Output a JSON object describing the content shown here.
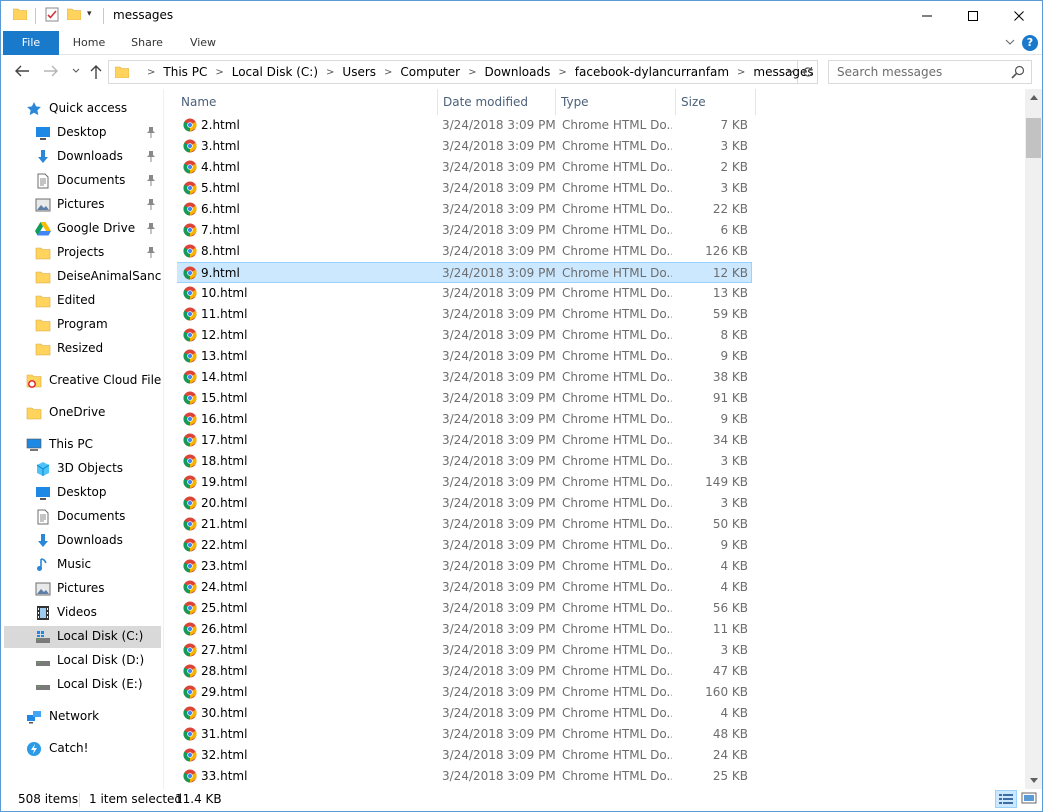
{
  "window": {
    "title": "messages",
    "controls": {
      "minimize": "—",
      "maximize": "☐",
      "close": "✕"
    }
  },
  "ribbon": {
    "tabs": [
      "File",
      "Home",
      "Share",
      "View"
    ],
    "help_label": "?"
  },
  "address": {
    "crumbs": [
      "This PC",
      "Local Disk (C:)",
      "Users",
      "Computer",
      "Downloads",
      "facebook-dylancurranfam",
      "messages"
    ]
  },
  "search": {
    "placeholder": "Search messages",
    "value": ""
  },
  "navigation": {
    "items": [
      {
        "label": "Quick access",
        "icon": "star-icon",
        "indent": 0,
        "pinned": false
      },
      {
        "label": "Desktop",
        "icon": "desktop-icon",
        "indent": 1,
        "pinned": true
      },
      {
        "label": "Downloads",
        "icon": "download-arrow-icon",
        "indent": 1,
        "pinned": true
      },
      {
        "label": "Documents",
        "icon": "document-icon",
        "indent": 1,
        "pinned": true
      },
      {
        "label": "Pictures",
        "icon": "pictures-icon",
        "indent": 1,
        "pinned": true
      },
      {
        "label": "Google Drive",
        "icon": "google-drive-icon",
        "indent": 1,
        "pinned": true
      },
      {
        "label": "Projects",
        "icon": "folder-icon",
        "indent": 1,
        "pinned": true
      },
      {
        "label": "DeiseAnimalSanctu",
        "icon": "folder-icon",
        "indent": 1,
        "pinned": false
      },
      {
        "label": "Edited",
        "icon": "folder-icon",
        "indent": 1,
        "pinned": false
      },
      {
        "label": "Program",
        "icon": "folder-icon",
        "indent": 1,
        "pinned": false
      },
      {
        "label": "Resized",
        "icon": "folder-icon",
        "indent": 1,
        "pinned": false
      },
      {
        "label": "Creative Cloud Files",
        "icon": "creative-cloud-icon",
        "indent": 0,
        "pinned": false
      },
      {
        "label": "OneDrive",
        "icon": "onedrive-icon",
        "indent": 0,
        "pinned": false
      },
      {
        "label": "This PC",
        "icon": "computer-icon",
        "indent": 0,
        "pinned": false
      },
      {
        "label": "3D Objects",
        "icon": "cube-icon",
        "indent": 1,
        "pinned": false
      },
      {
        "label": "Desktop",
        "icon": "desktop-icon",
        "indent": 1,
        "pinned": false
      },
      {
        "label": "Documents",
        "icon": "document-icon",
        "indent": 1,
        "pinned": false
      },
      {
        "label": "Downloads",
        "icon": "download-arrow-icon",
        "indent": 1,
        "pinned": false
      },
      {
        "label": "Music",
        "icon": "music-note-icon",
        "indent": 1,
        "pinned": false
      },
      {
        "label": "Pictures",
        "icon": "pictures-icon",
        "indent": 1,
        "pinned": false
      },
      {
        "label": "Videos",
        "icon": "film-icon",
        "indent": 1,
        "pinned": false
      },
      {
        "label": "Local Disk (C:)",
        "icon": "system-drive-icon",
        "indent": 1,
        "pinned": false,
        "selected": true
      },
      {
        "label": "Local Disk (D:)",
        "icon": "drive-icon",
        "indent": 1,
        "pinned": false
      },
      {
        "label": "Local Disk (E:)",
        "icon": "drive-icon",
        "indent": 1,
        "pinned": false
      },
      {
        "label": "Network",
        "icon": "network-icon",
        "indent": 0,
        "pinned": false
      },
      {
        "label": "Catch!",
        "icon": "catch-icon",
        "indent": 0,
        "pinned": false
      }
    ]
  },
  "filelist": {
    "columns": [
      "Name",
      "Date modified",
      "Type",
      "Size"
    ],
    "sort_arrow": "^",
    "files": [
      {
        "name": "2.html",
        "date": "3/24/2018 3:09 PM",
        "type": "Chrome HTML Do...",
        "size": "7 KB"
      },
      {
        "name": "3.html",
        "date": "3/24/2018 3:09 PM",
        "type": "Chrome HTML Do...",
        "size": "3 KB"
      },
      {
        "name": "4.html",
        "date": "3/24/2018 3:09 PM",
        "type": "Chrome HTML Do...",
        "size": "2 KB"
      },
      {
        "name": "5.html",
        "date": "3/24/2018 3:09 PM",
        "type": "Chrome HTML Do...",
        "size": "3 KB"
      },
      {
        "name": "6.html",
        "date": "3/24/2018 3:09 PM",
        "type": "Chrome HTML Do...",
        "size": "22 KB"
      },
      {
        "name": "7.html",
        "date": "3/24/2018 3:09 PM",
        "type": "Chrome HTML Do...",
        "size": "6 KB"
      },
      {
        "name": "8.html",
        "date": "3/24/2018 3:09 PM",
        "type": "Chrome HTML Do...",
        "size": "126 KB"
      },
      {
        "name": "9.html",
        "date": "3/24/2018 3:09 PM",
        "type": "Chrome HTML Do...",
        "size": "12 KB",
        "selected": true
      },
      {
        "name": "10.html",
        "date": "3/24/2018 3:09 PM",
        "type": "Chrome HTML Do...",
        "size": "13 KB"
      },
      {
        "name": "11.html",
        "date": "3/24/2018 3:09 PM",
        "type": "Chrome HTML Do...",
        "size": "59 KB"
      },
      {
        "name": "12.html",
        "date": "3/24/2018 3:09 PM",
        "type": "Chrome HTML Do...",
        "size": "8 KB"
      },
      {
        "name": "13.html",
        "date": "3/24/2018 3:09 PM",
        "type": "Chrome HTML Do...",
        "size": "9 KB"
      },
      {
        "name": "14.html",
        "date": "3/24/2018 3:09 PM",
        "type": "Chrome HTML Do...",
        "size": "38 KB"
      },
      {
        "name": "15.html",
        "date": "3/24/2018 3:09 PM",
        "type": "Chrome HTML Do...",
        "size": "91 KB"
      },
      {
        "name": "16.html",
        "date": "3/24/2018 3:09 PM",
        "type": "Chrome HTML Do...",
        "size": "9 KB"
      },
      {
        "name": "17.html",
        "date": "3/24/2018 3:09 PM",
        "type": "Chrome HTML Do...",
        "size": "34 KB"
      },
      {
        "name": "18.html",
        "date": "3/24/2018 3:09 PM",
        "type": "Chrome HTML Do...",
        "size": "3 KB"
      },
      {
        "name": "19.html",
        "date": "3/24/2018 3:09 PM",
        "type": "Chrome HTML Do...",
        "size": "149 KB"
      },
      {
        "name": "20.html",
        "date": "3/24/2018 3:09 PM",
        "type": "Chrome HTML Do...",
        "size": "3 KB"
      },
      {
        "name": "21.html",
        "date": "3/24/2018 3:09 PM",
        "type": "Chrome HTML Do...",
        "size": "50 KB"
      },
      {
        "name": "22.html",
        "date": "3/24/2018 3:09 PM",
        "type": "Chrome HTML Do...",
        "size": "9 KB"
      },
      {
        "name": "23.html",
        "date": "3/24/2018 3:09 PM",
        "type": "Chrome HTML Do...",
        "size": "4 KB"
      },
      {
        "name": "24.html",
        "date": "3/24/2018 3:09 PM",
        "type": "Chrome HTML Do...",
        "size": "4 KB"
      },
      {
        "name": "25.html",
        "date": "3/24/2018 3:09 PM",
        "type": "Chrome HTML Do...",
        "size": "56 KB"
      },
      {
        "name": "26.html",
        "date": "3/24/2018 3:09 PM",
        "type": "Chrome HTML Do...",
        "size": "11 KB"
      },
      {
        "name": "27.html",
        "date": "3/24/2018 3:09 PM",
        "type": "Chrome HTML Do...",
        "size": "3 KB"
      },
      {
        "name": "28.html",
        "date": "3/24/2018 3:09 PM",
        "type": "Chrome HTML Do...",
        "size": "47 KB"
      },
      {
        "name": "29.html",
        "date": "3/24/2018 3:09 PM",
        "type": "Chrome HTML Do...",
        "size": "160 KB"
      },
      {
        "name": "30.html",
        "date": "3/24/2018 3:09 PM",
        "type": "Chrome HTML Do...",
        "size": "4 KB"
      },
      {
        "name": "31.html",
        "date": "3/24/2018 3:09 PM",
        "type": "Chrome HTML Do...",
        "size": "48 KB"
      },
      {
        "name": "32.html",
        "date": "3/24/2018 3:09 PM",
        "type": "Chrome HTML Do...",
        "size": "24 KB"
      },
      {
        "name": "33.html",
        "date": "3/24/2018 3:09 PM",
        "type": "Chrome HTML Do...",
        "size": "25 KB"
      }
    ]
  },
  "status": {
    "item_count": "508 items",
    "selected": "1 item selected",
    "selected_size": "11.4 KB"
  },
  "colors": {
    "accent": "#1979ca",
    "selection_bg": "#cce8ff",
    "selection_border": "#99d1ff",
    "folder": "#ffd35c",
    "header_text": "#4c607a"
  }
}
